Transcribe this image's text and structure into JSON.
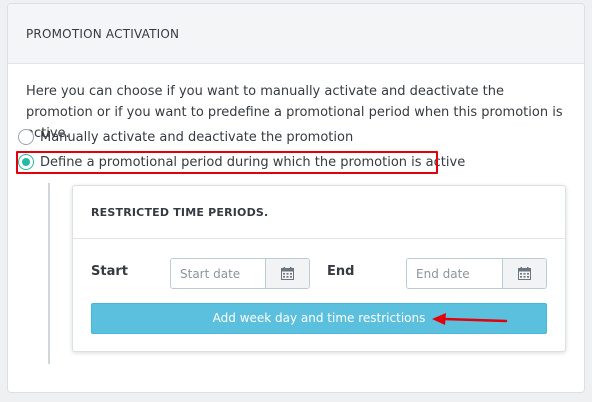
{
  "section": {
    "title": "PROMOTION ACTIVATION",
    "description": "Here you can choose if you want to manually activate and deactivate the promotion or if you want to predefine a promotional period when this promotion is active."
  },
  "options": [
    {
      "label": "Manually activate and deactivate the promotion",
      "selected": false
    },
    {
      "label": "Define a promotional period during which the promotion is active",
      "selected": true
    }
  ],
  "restricted": {
    "title": "RESTRICTED TIME PERIODS.",
    "start_label": "Start",
    "start_placeholder": "Start date",
    "start_value": "",
    "end_label": "End",
    "end_placeholder": "End date",
    "end_value": "",
    "calendar_icon": "calendar-icon",
    "add_button_label": "Add week day and time restrictions"
  },
  "annotations": {
    "highlight_color": "#e3000b",
    "arrow_color": "#e3000b"
  },
  "colors": {
    "radio_accent": "#25b9a7",
    "button_bg": "#5bc0de"
  }
}
